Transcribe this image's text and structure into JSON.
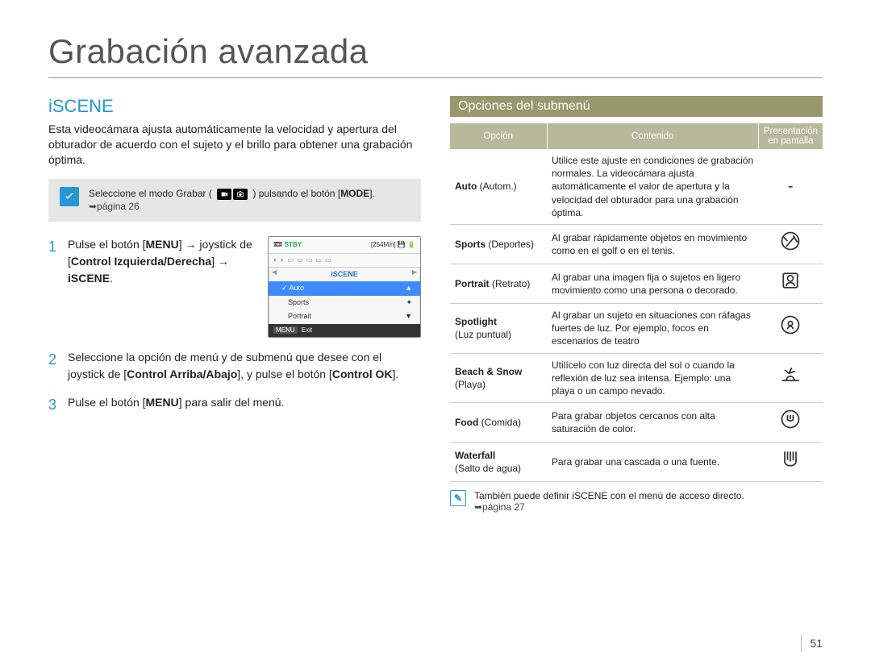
{
  "page": {
    "title": "Grabación avanzada",
    "number": "51"
  },
  "left": {
    "heading": "iSCENE",
    "intro": "Esta videocámara ajusta automáticamente la velocidad y apertura del obturador de acuerdo con el sujeto y el brillo para obtener una grabación óptima.",
    "notice": {
      "pre": "Seleccione el modo Grabar (",
      "post": ") pulsando el botón [",
      "mode": "MODE",
      "end": "].",
      "pageref": "➥página 26"
    },
    "steps": {
      "1": {
        "parts": [
          "Pulse el botón [",
          "MENU",
          "] → joystick de [",
          "Control Izquierda/Derecha",
          "] → ",
          "iSCENE",
          "."
        ]
      },
      "2": {
        "parts": [
          "Seleccione la opción de menú y de submenú que desee con el joystick de [",
          "Control Arriba/Abajo",
          "], y pulse el botón [",
          "Control OK",
          "]."
        ]
      },
      "3": {
        "parts": [
          "Pulse el botón [",
          "MENU",
          "] para salir del menú."
        ]
      }
    },
    "lcd": {
      "stby": "STBY",
      "time": "[254Min]",
      "tab": "iSCENE",
      "items": [
        {
          "label": "Auto",
          "selected": true
        },
        {
          "label": "Sports",
          "selected": false
        },
        {
          "label": "Portrait",
          "selected": false
        }
      ],
      "foot_label": "MENU",
      "foot_text": "Exit"
    }
  },
  "right": {
    "subhead": "Opciones del submenú",
    "thead": {
      "opt": "Opción",
      "cont": "Contenido",
      "disp": "Presentación en pantalla"
    },
    "rows": [
      {
        "en": "Auto",
        "es": " Autom.",
        "content": "Utilice este ajuste en condiciones de grabación normales. La videocámara ajusta automáticamente el valor de apertura y la velocidad del obturador para una grabación óptima.",
        "icon": "-",
        "plain": true
      },
      {
        "en": "Sports",
        "es": " Deportes",
        "content": "Al grabar rápidamente objetos en movimiento como en el golf o en el tenis.",
        "icon": "sports"
      },
      {
        "en": "Portrait",
        "es": " Retrato",
        "content": "Al grabar una imagen fija o sujetos en ligero movimiento como una persona o decorado.",
        "icon": "portrait"
      },
      {
        "en": "Spotlight",
        "es": "Luz puntual",
        "multiline": true,
        "content": "Al grabar un sujeto en situaciones con ráfagas fuertes de luz. Por ejemplo, focos en escenarios de teatro",
        "icon": "spotlight"
      },
      {
        "en": "Beach & Snow",
        "es": "Playa",
        "multiline": true,
        "content": "Utilícelo con luz directa del sol o cuando la reflexión de luz sea intensa. Ejemplo: una playa o un campo nevado.",
        "icon": "beach"
      },
      {
        "en": "Food",
        "es": " Comida",
        "content": "Para grabar objetos cercanos con alta saturación de color.",
        "icon": "food"
      },
      {
        "en": "Waterfall",
        "es": "Salto de agua",
        "multiline": true,
        "content": "Para grabar una cascada o una fuente.",
        "icon": "waterfall"
      }
    ],
    "note": {
      "text": "También puede definir iSCENE con el menú de acceso directo.",
      "pageref": "➥página 27"
    }
  }
}
